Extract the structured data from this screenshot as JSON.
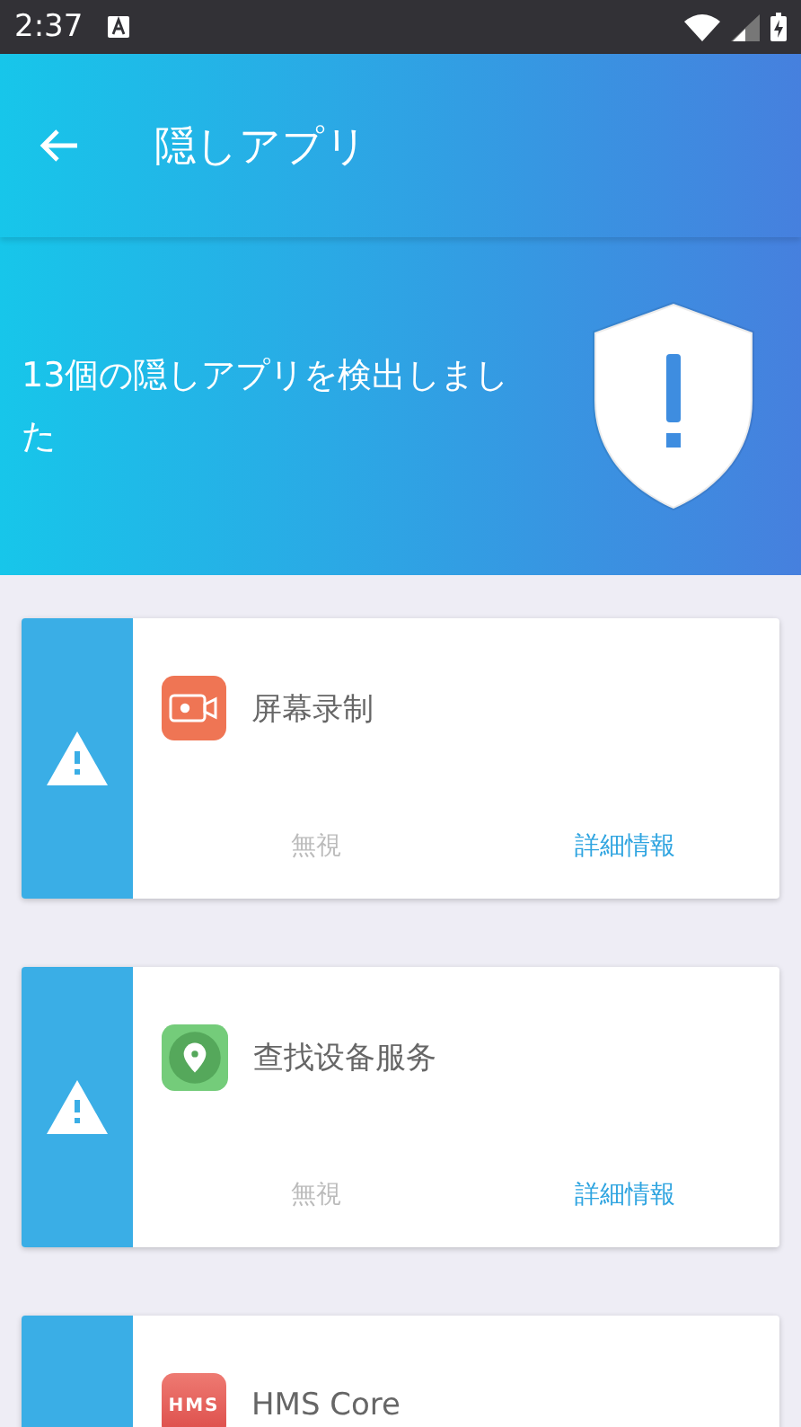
{
  "status_bar": {
    "time": "2:37"
  },
  "header": {
    "title": "隠しアプリ"
  },
  "banner": {
    "message": "13個の隠しアプリを検出しました"
  },
  "apps": [
    {
      "name": "屏幕录制",
      "actions": [
        {
          "label": "無視",
          "kind": "ignore"
        },
        {
          "label": "詳細情報",
          "kind": "details"
        }
      ]
    },
    {
      "name": "查找设备服务",
      "actions": [
        {
          "label": "無視",
          "kind": "ignore"
        },
        {
          "label": "詳細情報",
          "kind": "details"
        }
      ]
    },
    {
      "name": "HMS Core",
      "icon_label": "HMS"
    }
  ]
}
